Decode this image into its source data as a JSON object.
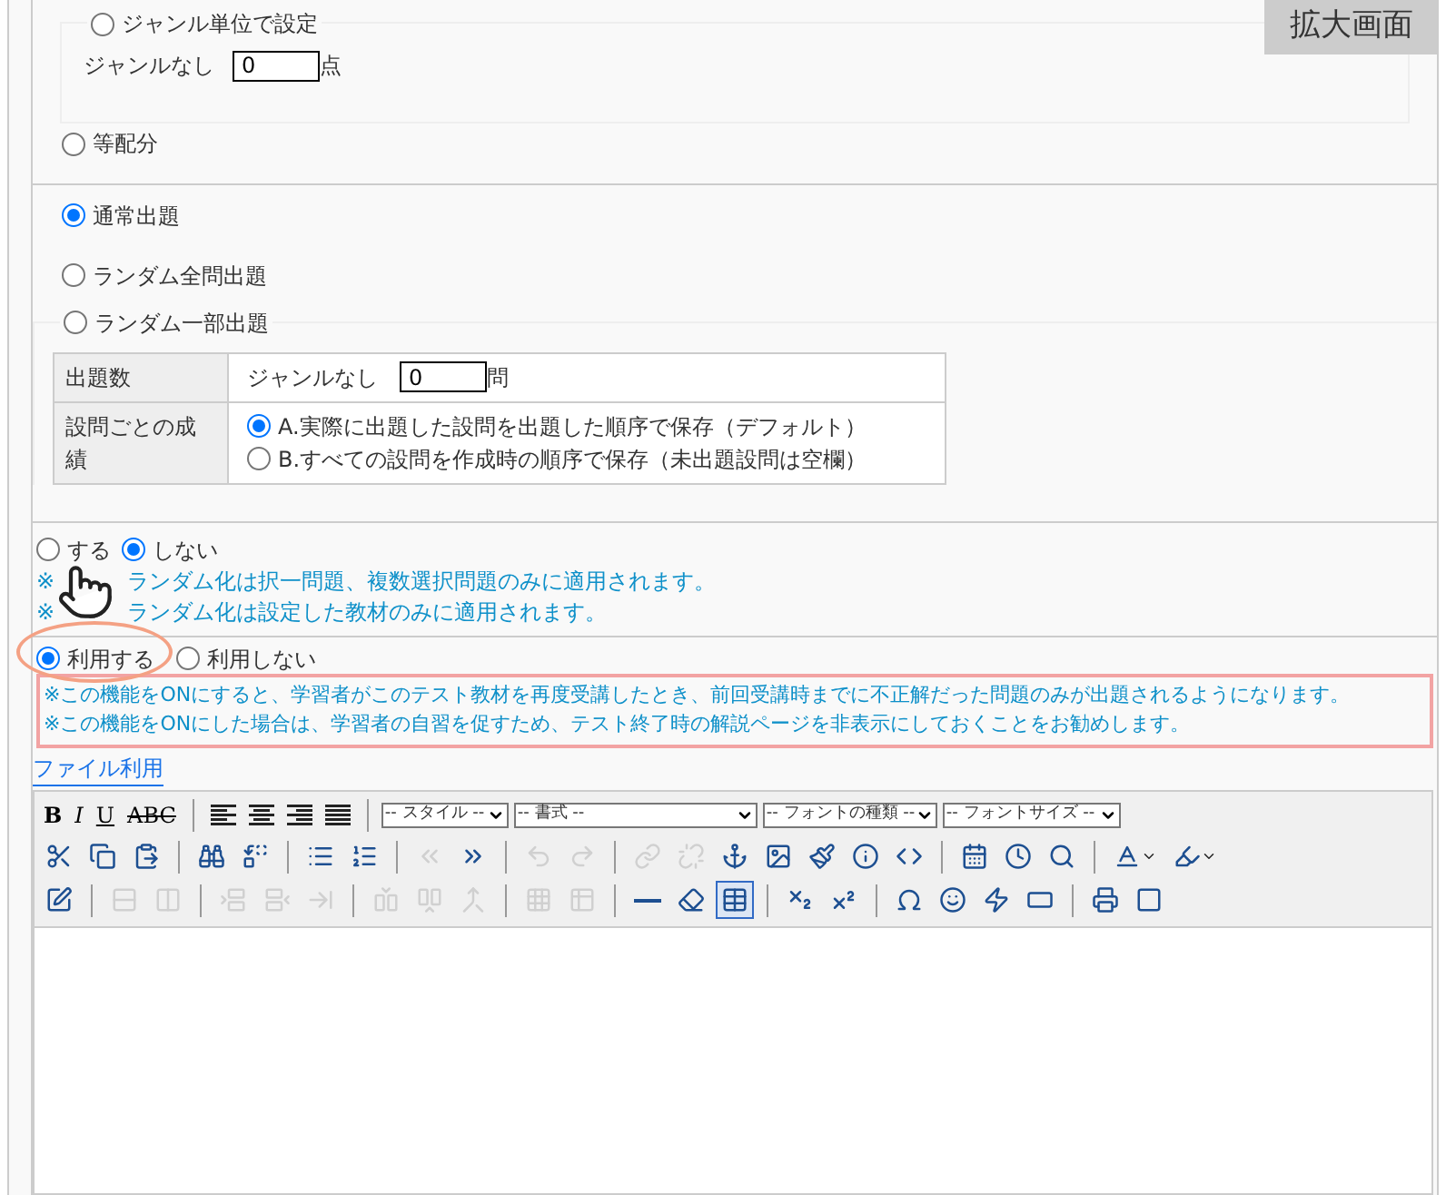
{
  "zoom_label": "拡大画面",
  "scoring": {
    "options": [
      {
        "label": "ジャンル単位で設定",
        "selected": false
      },
      {
        "label": "等配分",
        "selected": false
      }
    ],
    "genre_label": "ジャンルなし",
    "genre_value": "0",
    "genre_unit": "点"
  },
  "order": {
    "options": [
      {
        "label": "通常出題",
        "selected": true
      },
      {
        "label": "ランダム全問出題",
        "selected": false
      },
      {
        "label": "ランダム一部出題",
        "selected": false
      }
    ],
    "count_header": "出題数",
    "count_label": "ジャンルなし",
    "count_value": "0",
    "count_unit": "問",
    "grade_header": "設問ごとの成績",
    "grade_options": [
      {
        "label": "A.実際に出題した設問を出題した順序で保存（デフォルト）",
        "selected": true
      },
      {
        "label": "B.すべての設問を作成時の順序で保存（未出題設問は空欄）",
        "selected": false
      }
    ]
  },
  "shuffle": {
    "options": [
      {
        "label": "する",
        "selected": false
      },
      {
        "label": "しない",
        "selected": true
      }
    ],
    "notes": [
      {
        "mark": "※",
        "text": "ランダム化は択一問題、複数選択問題のみに適用されます。"
      },
      {
        "mark": "※",
        "text": "ランダム化は設定した教材のみに適用されます。"
      }
    ]
  },
  "retry": {
    "options": [
      {
        "label": "利用する",
        "selected": true
      },
      {
        "label": "利用しない",
        "selected": false
      }
    ],
    "notes": [
      "※この機能をONにすると、学習者がこのテスト教材を再度受講したとき、前回受講時までに不正解だった問題のみが出題されるようになります。",
      "※この機能をONにした場合は、学習者の自習を促すため、テスト終了時の解説ページを非表示にしておくことをお勧めします。"
    ]
  },
  "file_link": "ファイル利用",
  "editor": {
    "format_buttons": [
      "B",
      "I",
      "U",
      "ABC"
    ],
    "dropdowns": [
      "-- スタイル --",
      "-- 書式 --",
      "-- フォントの種類 --",
      "-- フォントサイズ --"
    ],
    "toolbar_rows": [
      [
        {
          "kind": "button",
          "disabled": false,
          "active": false
        },
        {
          "kind": "button",
          "disabled": false,
          "active": false
        },
        {
          "kind": "button",
          "disabled": false,
          "active": false
        },
        {
          "kind": "separator"
        },
        {
          "kind": "button",
          "disabled": false,
          "active": false
        },
        {
          "kind": "button",
          "disabled": false,
          "active": false
        },
        {
          "kind": "separator"
        },
        {
          "kind": "button",
          "disabled": false,
          "active": false
        },
        {
          "kind": "button",
          "disabled": false,
          "active": false
        },
        {
          "kind": "separator"
        },
        {
          "kind": "button",
          "disabled": true,
          "active": false
        },
        {
          "kind": "button",
          "disabled": false,
          "active": false
        },
        {
          "kind": "separator"
        },
        {
          "kind": "button",
          "disabled": true,
          "active": false
        },
        {
          "kind": "button",
          "disabled": true,
          "active": false
        },
        {
          "kind": "separator"
        },
        {
          "kind": "button",
          "disabled": true,
          "active": false
        },
        {
          "kind": "button",
          "disabled": true,
          "active": false
        },
        {
          "kind": "button",
          "disabled": false,
          "active": false
        },
        {
          "kind": "button",
          "disabled": false,
          "active": false
        },
        {
          "kind": "button",
          "disabled": false,
          "active": false
        },
        {
          "kind": "button",
          "disabled": false,
          "active": false
        },
        {
          "kind": "button",
          "disabled": false,
          "active": false
        },
        {
          "kind": "separator"
        },
        {
          "kind": "button",
          "disabled": false,
          "active": false
        },
        {
          "kind": "button",
          "disabled": false,
          "active": false
        },
        {
          "kind": "button",
          "disabled": false,
          "active": false
        },
        {
          "kind": "separator"
        },
        {
          "kind": "menu",
          "disabled": false,
          "active": false
        },
        {
          "kind": "menu",
          "disabled": false,
          "active": false
        }
      ],
      [
        {
          "kind": "button",
          "disabled": false,
          "active": false
        },
        {
          "kind": "separator"
        },
        {
          "kind": "button",
          "disabled": true,
          "active": false
        },
        {
          "kind": "button",
          "disabled": true,
          "active": false
        },
        {
          "kind": "separator"
        },
        {
          "kind": "button",
          "disabled": true,
          "active": false
        },
        {
          "kind": "button",
          "disabled": true,
          "active": false
        },
        {
          "kind": "button",
          "disabled": true,
          "active": false
        },
        {
          "kind": "separator"
        },
        {
          "kind": "button",
          "disabled": true,
          "active": false
        },
        {
          "kind": "button",
          "disabled": true,
          "active": false
        },
        {
          "kind": "button",
          "disabled": true,
          "active": false
        },
        {
          "kind": "separator"
        },
        {
          "kind": "button",
          "disabled": true,
          "active": false
        },
        {
          "kind": "button",
          "disabled": true,
          "active": false
        },
        {
          "kind": "separator"
        },
        {
          "kind": "button",
          "disabled": false,
          "active": false
        },
        {
          "kind": "button",
          "disabled": false,
          "active": false
        },
        {
          "kind": "button",
          "disabled": false,
          "active": true
        },
        {
          "kind": "separator"
        },
        {
          "kind": "button",
          "disabled": false,
          "active": false
        },
        {
          "kind": "button",
          "disabled": false,
          "active": false
        },
        {
          "kind": "separator"
        },
        {
          "kind": "button",
          "disabled": false,
          "active": false
        },
        {
          "kind": "button",
          "disabled": false,
          "active": false
        },
        {
          "kind": "button",
          "disabled": false,
          "active": false
        },
        {
          "kind": "button",
          "disabled": false,
          "active": false
        },
        {
          "kind": "separator"
        },
        {
          "kind": "button",
          "disabled": false,
          "active": false
        },
        {
          "kind": "button",
          "disabled": false,
          "active": false
        }
      ]
    ]
  }
}
